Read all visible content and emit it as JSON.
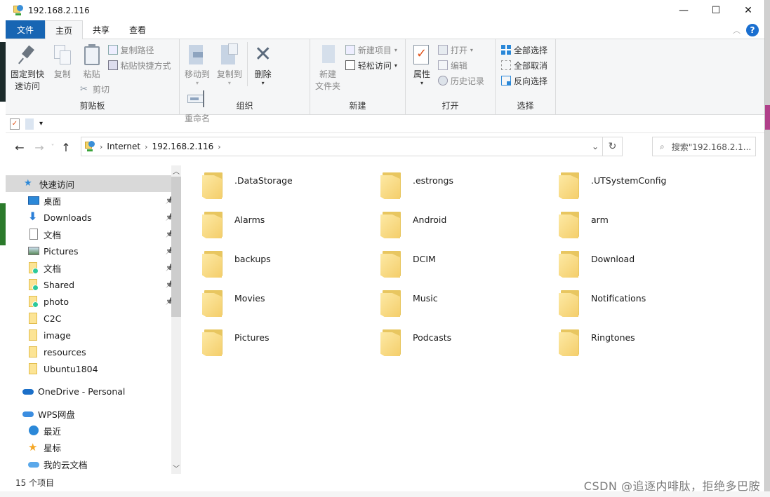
{
  "window": {
    "title": "192.168.2.116",
    "controls": {
      "minimize": "—",
      "maximize": "☐",
      "close": "✕"
    }
  },
  "ribbon_tabs": [
    {
      "label": "文件",
      "type": "file"
    },
    {
      "label": "主页",
      "active": true
    },
    {
      "label": "共享"
    },
    {
      "label": "查看"
    }
  ],
  "ribbon": {
    "clipboard": {
      "label": "剪贴板",
      "pin_quick_access": "固定到快\n速访问",
      "pin_line1": "固定到快",
      "pin_line2": "速访问",
      "copy": "复制",
      "paste": "粘贴",
      "copy_path": "复制路径",
      "paste_shortcut": "粘贴快捷方式",
      "cut": "剪切"
    },
    "organize": {
      "label": "组织",
      "move_to": "移动到",
      "copy_to": "复制到",
      "delete": "删除",
      "rename": "重命名"
    },
    "new": {
      "label": "新建",
      "new_folder_line1": "新建",
      "new_folder_line2": "文件夹",
      "new_item": "新建项目",
      "easy_access": "轻松访问"
    },
    "open": {
      "label": "打开",
      "properties": "属性",
      "open": "打开",
      "edit": "编辑",
      "history": "历史记录"
    },
    "select": {
      "label": "选择",
      "select_all": "全部选择",
      "select_none": "全部取消",
      "invert": "反向选择"
    }
  },
  "address": {
    "crumbs": [
      "Internet",
      "192.168.2.116"
    ],
    "search_placeholder": "搜索\"192.168.2.1..."
  },
  "sidebar": {
    "quick_access": "快速访问",
    "items": [
      {
        "label": "桌面",
        "icon": "desktop",
        "pinned": true
      },
      {
        "label": "Downloads",
        "icon": "download",
        "pinned": true
      },
      {
        "label": "文档",
        "icon": "document",
        "pinned": true
      },
      {
        "label": "Pictures",
        "icon": "pictures",
        "pinned": true
      },
      {
        "label": "文档",
        "icon": "folder-synced",
        "pinned": true
      },
      {
        "label": "Shared",
        "icon": "folder-synced",
        "pinned": true
      },
      {
        "label": "photo",
        "icon": "folder-synced",
        "pinned": true
      },
      {
        "label": "C2C",
        "icon": "folder",
        "pinned": false
      },
      {
        "label": "image",
        "icon": "folder",
        "pinned": false
      },
      {
        "label": "resources",
        "icon": "folder",
        "pinned": false
      },
      {
        "label": "Ubuntu1804",
        "icon": "folder",
        "pinned": false
      }
    ],
    "onedrive": "OneDrive - Personal",
    "wps": "WPS网盘",
    "wps_items": [
      {
        "label": "最近",
        "icon": "clock"
      },
      {
        "label": "星标",
        "icon": "star"
      },
      {
        "label": "我的云文档",
        "icon": "cloud"
      }
    ]
  },
  "folders": [
    ".DataStorage",
    ".estrongs",
    ".UTSystemConfig",
    "Alarms",
    "Android",
    "arm",
    "backups",
    "DCIM",
    "Download",
    "Movies",
    "Music",
    "Notifications",
    "Pictures",
    "Podcasts",
    "Ringtones"
  ],
  "status": {
    "item_count": "15 个项目"
  },
  "watermark": "CSDN @追逐内啡肽，拒绝多巴胺"
}
